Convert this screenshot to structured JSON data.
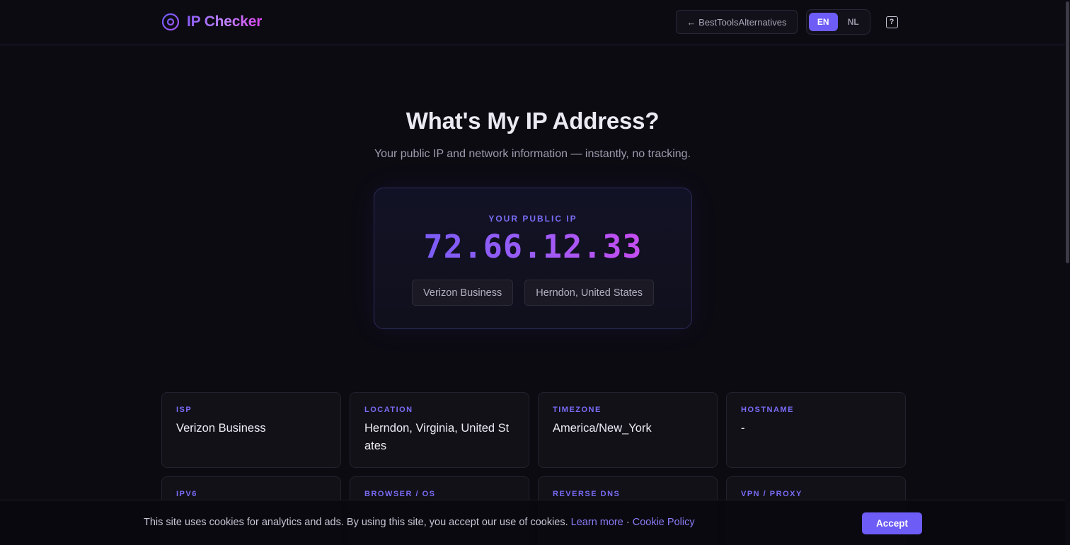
{
  "header": {
    "brand_name": "IP Checker",
    "back_link": "← BestToolsAlternatives",
    "languages": [
      {
        "code": "EN",
        "active": true
      },
      {
        "code": "NL",
        "active": false
      }
    ],
    "help_icon": "?"
  },
  "hero": {
    "title": "What's My IP Address?",
    "subtitle": "Your public IP and network information — instantly, no tracking."
  },
  "ip_card": {
    "label": "YOUR PUBLIC IP",
    "ip": "72.66.12.33",
    "chips": [
      "Verizon Business",
      "Herndon, United States"
    ]
  },
  "info_cards": [
    {
      "label": "ISP",
      "value": "Verizon Business"
    },
    {
      "label": "LOCATION",
      "value": "Herndon, Virginia, United States"
    },
    {
      "label": "TIMEZONE",
      "value": "America/New_York"
    },
    {
      "label": "HOSTNAME",
      "value": "-"
    },
    {
      "label": "IPV6",
      "value": ""
    },
    {
      "label": "BROWSER / OS",
      "value": ""
    },
    {
      "label": "REVERSE DNS",
      "value": ""
    },
    {
      "label": "VPN / PROXY",
      "value": ""
    }
  ],
  "cookie_bar": {
    "text": "This site uses cookies for analytics and ads. By using this site, you accept our use of cookies.",
    "learn_more": "Learn more",
    "separator": "·",
    "cookie_policy": "Cookie Policy",
    "accept": "Accept"
  },
  "colors": {
    "background": "#0c0b12",
    "accent": "#6d5cf6",
    "accent_pink": "#d946ef",
    "label": "#7a6cf7"
  },
  "icons": {
    "brand": "crosshair-icon",
    "help": "question-box-icon"
  }
}
